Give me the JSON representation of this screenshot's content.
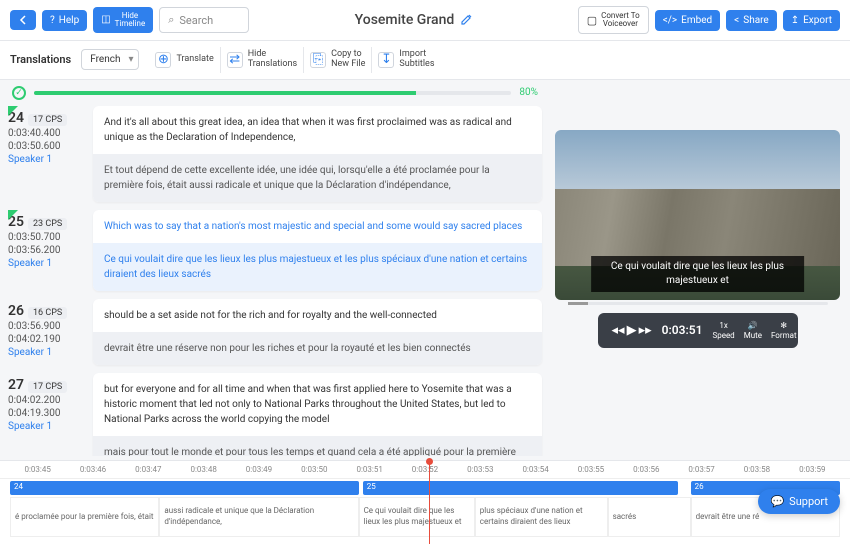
{
  "header": {
    "help": "Help",
    "hide_timeline": "Hide\nTimeline",
    "search": "Search",
    "title": "Yosemite Grand",
    "convert": "Convert To\nVoiceover",
    "embed": "Embed",
    "share": "Share",
    "export": "Export"
  },
  "toolbar": {
    "translations": "Translations",
    "language": "French",
    "translate": "Translate",
    "hide_trans": "Hide\nTranslations",
    "copy_new": "Copy to\nNew File",
    "import_subs": "Import\nSubtitles"
  },
  "progress": {
    "pct": "80%"
  },
  "segments": [
    {
      "num": "24",
      "cps": "17 CPS",
      "t1": "0:03:40.400",
      "t2": "0:03:50.600",
      "speaker": "Speaker 1",
      "orig": "And it's all about this great idea, an idea that when it was first proclaimed was as radical and unique as the Declaration of Independence,",
      "trans": "Et tout dépend de cette excellente idée, une idée qui, lorsqu'elle a été proclamée pour la première fois, était aussi radicale et unique que la Déclaration d'indépendance,",
      "active": false,
      "done": true
    },
    {
      "num": "25",
      "cps": "23 CPS",
      "t1": "0:03:50.700",
      "t2": "0:03:56.200",
      "speaker": "Speaker 1",
      "orig": "Which was to say that a nation's most majestic and special and some would say sacred places",
      "trans": "Ce qui voulait dire que les lieux les plus majestueux et les plus spéciaux d'une nation et certains diraient des lieux sacrés",
      "active": true,
      "done": true
    },
    {
      "num": "26",
      "cps": "16 CPS",
      "t1": "0:03:56.900",
      "t2": "0:04:02.190",
      "speaker": "Speaker 1",
      "orig": "should be a set aside not for the rich and for royalty and the well-connected",
      "trans": "devrait être une réserve non pour les riches et pour la royauté et les bien connectés",
      "active": false,
      "done": false
    },
    {
      "num": "27",
      "cps": "17 CPS",
      "t1": "0:04:02.200",
      "t2": "0:04:19.300",
      "speaker": "Speaker 1",
      "orig": "but for everyone and for all time and when that was first applied here to Yosemite that was a historic moment that led not only to National Parks throughout the United States, but led to National Parks across the world copying the model",
      "trans": "mais pour tout le monde et pour tous les temps et quand cela a été appliqué pour la première fois",
      "active": false,
      "done": false
    }
  ],
  "video": {
    "caption": "Ce qui voulait dire que les lieux les plus majestueux et",
    "time": "0:03:51",
    "speed": "1x",
    "speed_lbl": "Speed",
    "mute": "Mute",
    "format": "Format"
  },
  "timeline": {
    "ticks": [
      "0:03:45",
      "0:03:46",
      "0:03:47",
      "0:03:48",
      "0:03:49",
      "0:03:50",
      "0:03:51",
      "0:03:52",
      "0:03:53",
      "0:03:54",
      "0:03:55",
      "0:03:56",
      "0:03:57",
      "0:03:58",
      "0:03:59"
    ],
    "clip24": "24",
    "clip25": "25",
    "clip26": "26",
    "cells": [
      {
        "w": "18%",
        "txt": "é proclamée pour la première fois, était"
      },
      {
        "w": "24%",
        "txt": "aussi radicale et unique que la Déclaration d'indépendance,"
      },
      {
        "w": "14%",
        "txt": "Ce qui voulait dire que les lieux les plus majestueux et"
      },
      {
        "w": "16%",
        "txt": "plus spéciaux d'une nation et certains diraient des lieux"
      },
      {
        "w": "10%",
        "txt": "sacrés"
      },
      {
        "w": "18%",
        "txt": "devrait être une ré"
      }
    ]
  },
  "support": "Support"
}
